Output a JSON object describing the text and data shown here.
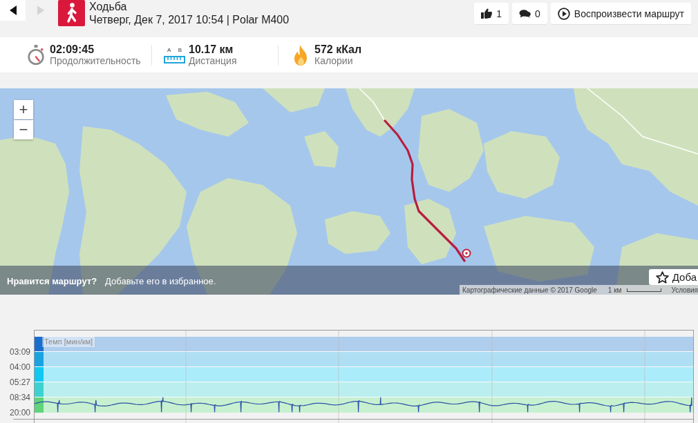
{
  "nav_buttons": [
    {
      "kind": "back",
      "disabled": false
    },
    {
      "kind": "forward",
      "disabled": true
    }
  ],
  "activity": {
    "kind": "walking",
    "title": "Ходьба",
    "subtitle": "Четверг, Дек 7, 2017 10:54 | Polar M400"
  },
  "actions": [
    {
      "kind": "like",
      "label": "1"
    },
    {
      "kind": "comments",
      "label": "0"
    },
    {
      "kind": "play",
      "label": "Воспроизвести маршрут"
    }
  ],
  "stats": [
    {
      "kind": "duration",
      "value": "02:09:45",
      "label": "Продолжительность"
    },
    {
      "kind": "distance",
      "icon_text": [
        "A",
        "B"
      ],
      "value": "10.17 км",
      "label": "Дистанция"
    },
    {
      "kind": "calories",
      "value": "572 кКал",
      "label": "Калории"
    }
  ],
  "map": {
    "zoom_controls": [
      "+",
      "−"
    ],
    "prompt": {
      "question": "Нравится маршрут?",
      "text": "Добавьте его в избранное."
    },
    "favorite_button": "Доба",
    "attribution": "Картографические данные © 2017 Google",
    "scale": "1 км",
    "terms": "Условия"
  },
  "pace_chart": {
    "title": "Темп [мин/км]",
    "zones": [
      {
        "label": "03:09",
        "color": "#1a6fcc"
      },
      {
        "label": "04:00",
        "color": "#1aa3e0"
      },
      {
        "label": "05:27",
        "color": "#10c8f2"
      },
      {
        "label": "08:34",
        "color": "#3dd2d2"
      },
      {
        "label": "20:00",
        "color": "#5fd47a"
      }
    ]
  }
}
